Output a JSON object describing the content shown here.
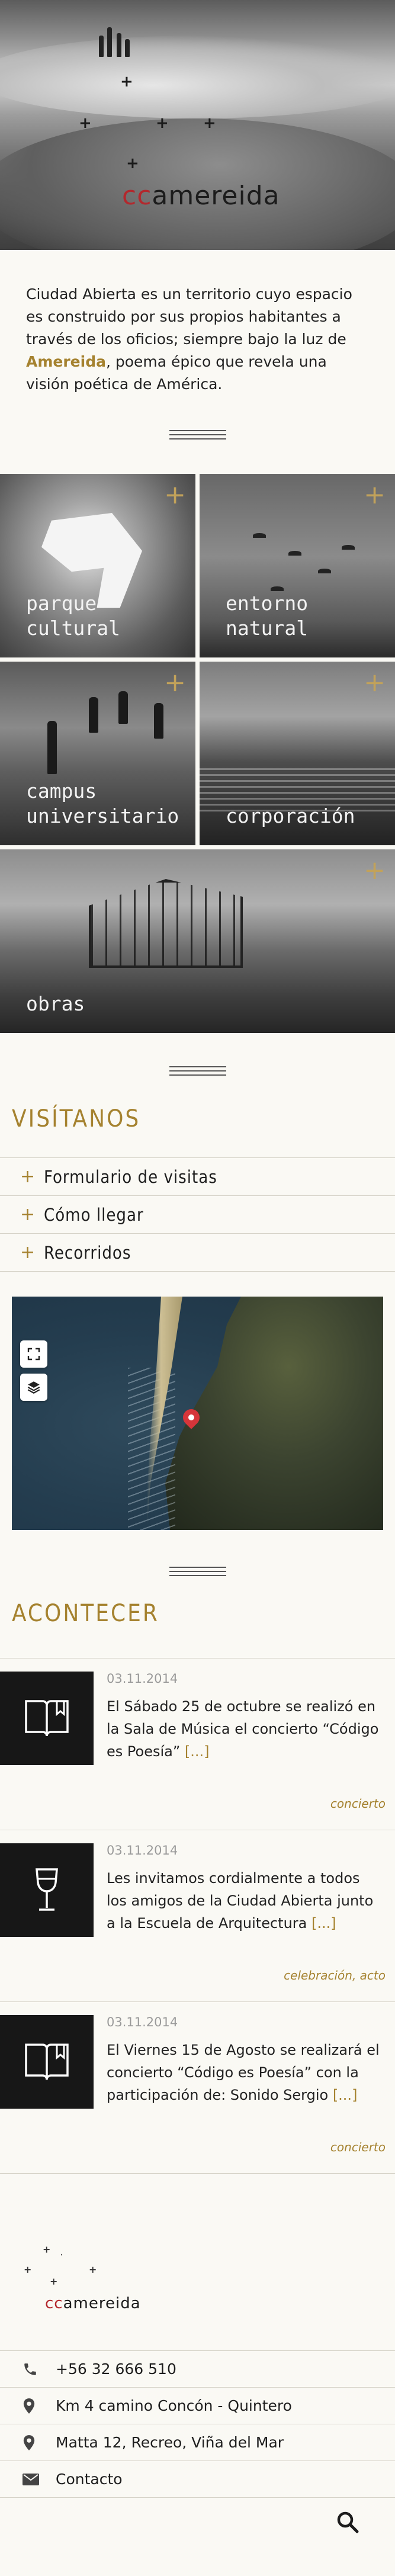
{
  "brand": {
    "logo_prefix": "cc",
    "logo_suffix": "amereida"
  },
  "intro": {
    "text_before": "Ciudad Abierta es un territorio cuyo espacio es construido por sus propios habitantes a través de los oficios; siempre bajo la luz de ",
    "highlight": "Amereida",
    "text_after": ", poema épico que revela una visión poética de América."
  },
  "tiles": [
    {
      "line1": "parque",
      "line2": "cultural"
    },
    {
      "line1": "entorno",
      "line2": "natural"
    },
    {
      "line1": "campus",
      "line2": "universitario"
    },
    {
      "line1": "corporación",
      "line2": ""
    },
    {
      "line1": "obras",
      "line2": ""
    }
  ],
  "visit": {
    "title": "VISÍTANOS",
    "items": [
      "Formulario de visitas",
      "Cómo llegar",
      "Recorridos"
    ]
  },
  "map": {
    "icons": [
      "fullscreen-icon",
      "layers-icon"
    ]
  },
  "news": {
    "title": "ACONTECER",
    "more_label": "[...]",
    "items": [
      {
        "icon": "book-icon",
        "date": "03.11.2014",
        "text": "El Sábado 25 de octubre se realizó en la Sala de Música el concierto “Código es Poesía”",
        "tags": "concierto"
      },
      {
        "icon": "wine-glass-icon",
        "date": "03.11.2014",
        "text": "Les invitamos cordialmente a todos los amigos de la Ciudad Abierta junto a la Escuela de Arquitectura",
        "tags": "celebración, acto"
      },
      {
        "icon": "book-icon",
        "date": "03.11.2014",
        "text": "El Viernes 15 de Agosto se realizará el concierto “Código es Poesía” con la participación de: Sonido Sergio",
        "tags": "concierto"
      }
    ]
  },
  "contact": {
    "phone": "+56 32 666 510",
    "address1": "Km 4 camino Concón - Quintero",
    "address2": "Matta 12, Recreo, Viña del Mar",
    "email_label": "Contacto"
  },
  "colors": {
    "accent": "#a5822f",
    "logo_red": "#b3282d",
    "tile_plus": "#c2a25a",
    "dark": "#171717"
  }
}
